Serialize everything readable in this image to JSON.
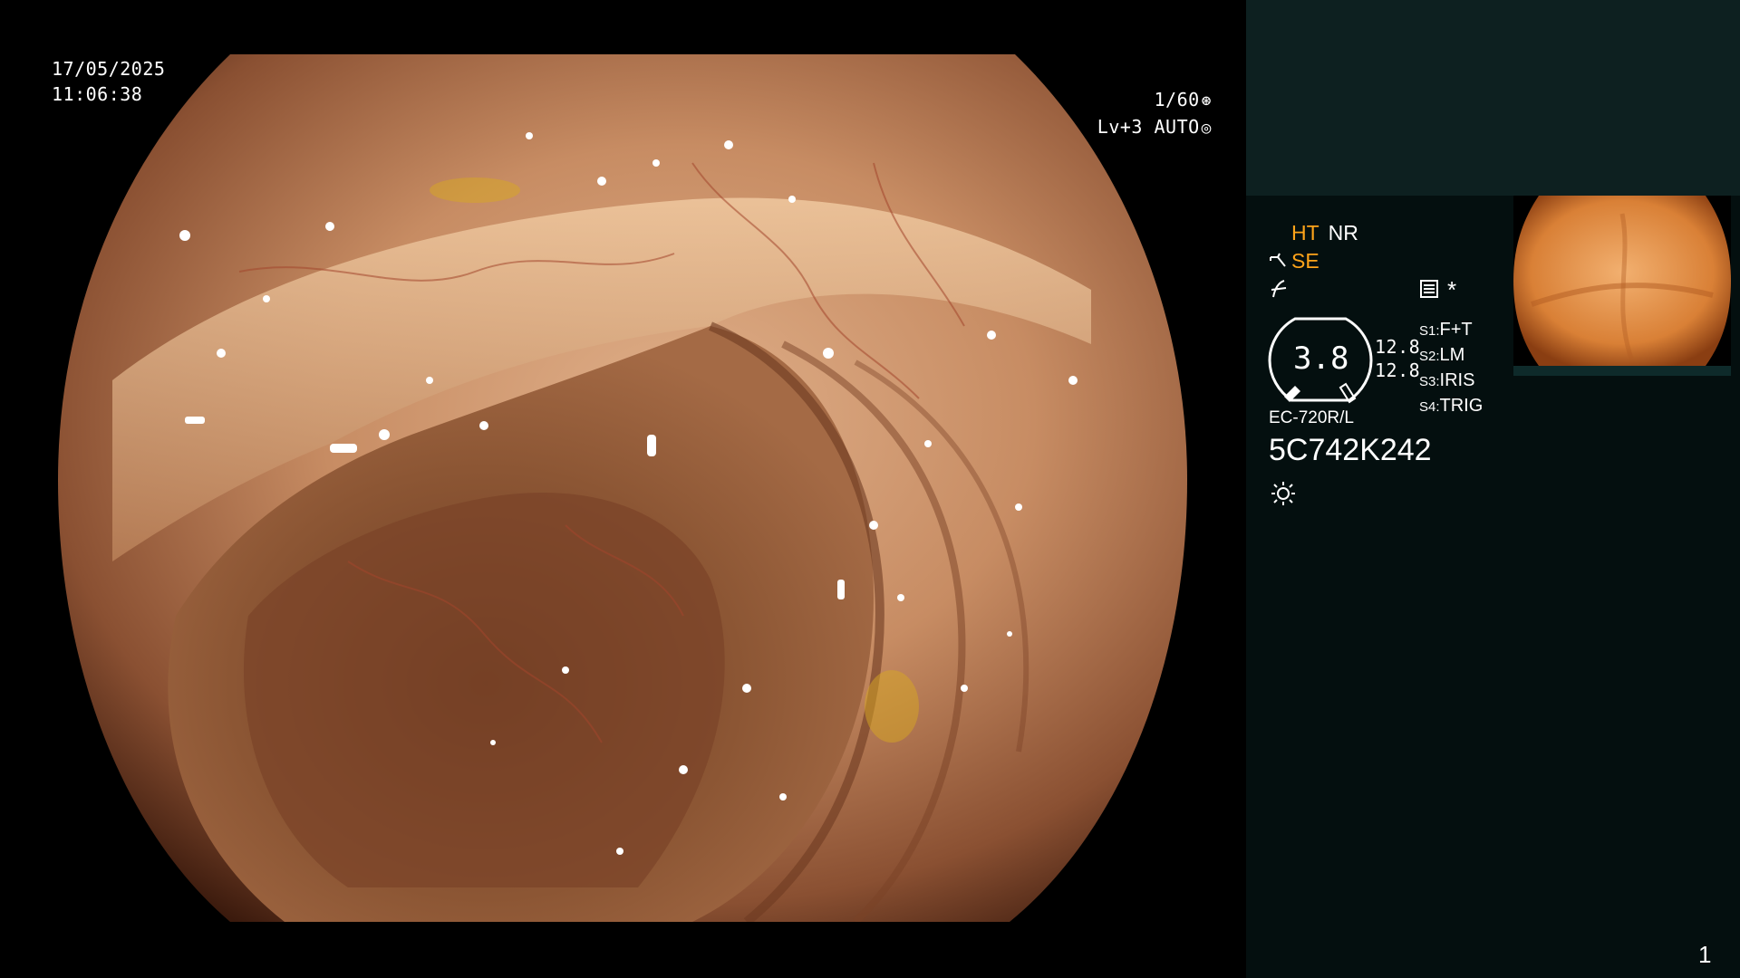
{
  "overlay": {
    "date": "17/05/2025",
    "time": "11:06:38",
    "shutter": "1/60",
    "level_mode": "Lv+3 AUTO"
  },
  "panel": {
    "ht": "HT",
    "nr": "NR",
    "se": "SE",
    "zoom_value": "3.8",
    "val1": "12.8",
    "val2": "12.8",
    "switches": [
      {
        "key": "S1:",
        "value": "F+T"
      },
      {
        "key": "S2:",
        "value": "LM"
      },
      {
        "key": "S3:",
        "value": "IRIS"
      },
      {
        "key": "S4:",
        "value": "TRIG"
      }
    ],
    "scope_model": "EC-720R/L",
    "serial": "5C742K242",
    "page_number": "1"
  },
  "colors": {
    "panel_bg": "#040f0f",
    "panel_top_bg": "#0d2020",
    "accent_orange": "#ffa41a"
  },
  "icons": [
    "shutter-icon",
    "iris-icon",
    "endoscope-icon",
    "enhance-icon",
    "settings-card-icon",
    "asterisk-icon",
    "light-icon"
  ]
}
